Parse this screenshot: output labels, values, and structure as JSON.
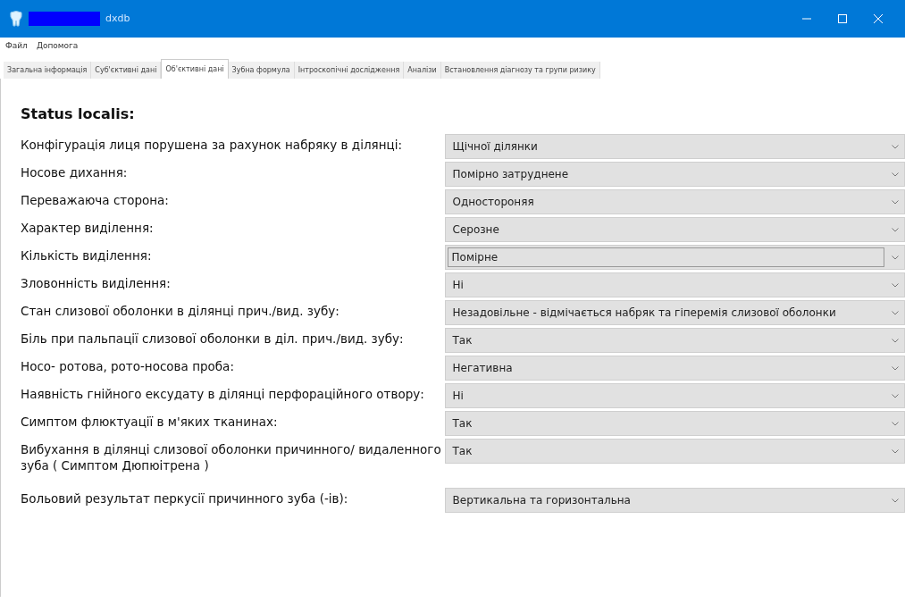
{
  "window": {
    "title": "dxdb"
  },
  "menu": [
    "Файл",
    "Допомога"
  ],
  "tabs": [
    {
      "label": "Загальна інформація",
      "selected": false
    },
    {
      "label": "Суб'єктивні дані",
      "selected": false
    },
    {
      "label": "Об'єктивні дані",
      "selected": true
    },
    {
      "label": "Зубна формула",
      "selected": false
    },
    {
      "label": "Інтроскопічні дослідження",
      "selected": false
    },
    {
      "label": "Аналізи",
      "selected": false
    },
    {
      "label": "Встановлення діагнозу та групи ризику",
      "selected": false
    }
  ],
  "heading": "Status localis:",
  "fields": [
    {
      "label": "Конфігурація лиця порушена за рахунок набряку в ділянці:",
      "value": "Щічної ділянки",
      "focused": false
    },
    {
      "label": "Носове дихання:",
      "value": "Помірно затруднене",
      "focused": false
    },
    {
      "label": "Переважаюча сторона:",
      "value": "Одностороняя",
      "focused": false
    },
    {
      "label": "Характер виділення:",
      "value": "Серозне",
      "focused": false
    },
    {
      "label": "Кількість виділення:",
      "value": "Помірне",
      "focused": true
    },
    {
      "label": "Зловонність виділення:",
      "value": "Ні",
      "focused": false
    },
    {
      "label": "Стан слизової оболонки в ділянці прич./вид. зубу:",
      "value": "Незадовільне - відмічається набряк та гіперемія слизової оболонки",
      "focused": false
    },
    {
      "label": "Біль при пальпації слизової оболонки в діл. прич./вид. зубу:",
      "value": "Так",
      "focused": false
    },
    {
      "label": "Носо- ротова, рото-носова  проба:",
      "value": "Негативна",
      "focused": false
    },
    {
      "label": "Наявність гнійного ексудату в ділянці перфораційного отвору:",
      "value": "Ні",
      "focused": false
    },
    {
      "label": "Симптом флюктуації в м'яких тканинах:",
      "value": "Так",
      "focused": false
    },
    {
      "label": "Вибухання в ділянці слизової оболонки причинного/ видаленного зуба ( Симптом Дюпюітрена )",
      "value": "Так",
      "focused": false
    },
    {
      "label": "Больовий результат перкусії причинного зуба (-ів):",
      "value": "Вертикальна та горизонтальна",
      "focused": false
    }
  ]
}
